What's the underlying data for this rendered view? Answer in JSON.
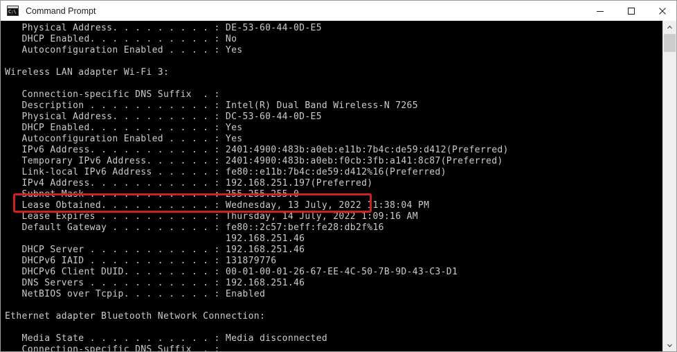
{
  "window": {
    "title": "Command Prompt",
    "icon": "command-prompt-icon",
    "icon_glyph": "C:\\",
    "controls": {
      "minimize": "Minimize",
      "maximize": "Maximize",
      "close": "Close"
    }
  },
  "colors": {
    "titlebar_bg": "#ffffff",
    "console_bg": "#000000",
    "console_text": "#cccccc",
    "highlight_red": "#cc2222",
    "scrollbar_track": "#efefef",
    "scrollbar_thumb": "#cdcdcd"
  },
  "console": {
    "lines": [
      "   Physical Address. . . . . . . . . : DE-53-60-44-0D-E5",
      "   DHCP Enabled. . . . . . . . . . . : No",
      "   Autoconfiguration Enabled . . . . : Yes",
      "",
      "Wireless LAN adapter Wi-Fi 3:",
      "",
      "   Connection-specific DNS Suffix  . :",
      "   Description . . . . . . . . . . . : Intel(R) Dual Band Wireless-N 7265",
      "   Physical Address. . . . . . . . . : DC-53-60-44-0D-E5",
      "   DHCP Enabled. . . . . . . . . . . : Yes",
      "   Autoconfiguration Enabled . . . . : Yes",
      "   IPv6 Address. . . . . . . . . . . : 2401:4900:483b:a0eb:e11b:7b4c:de59:d412(Preferred)",
      "   Temporary IPv6 Address. . . . . . : 2401:4900:483b:a0eb:f0cb:3fb:a141:8c87(Preferred)",
      "   Link-local IPv6 Address . . . . . : fe80::e11b:7b4c:de59:d412%16(Preferred)",
      "   IPv4 Address. . . . . . . . . . . : 192.168.251.197(Preferred)",
      "   Subnet Mask . . . . . . . . . . . : 255.255.255.0",
      "   Lease Obtained. . . . . . . . . . : Wednesday, 13 July, 2022 11:38:04 PM",
      "   Lease Expires . . . . . . . . . . : Thursday, 14 July, 2022 1:09:16 AM",
      "   Default Gateway . . . . . . . . . : fe80::2c57:beff:fe28:db2f%16",
      "                                       192.168.251.46",
      "   DHCP Server . . . . . . . . . . . : 192.168.251.46",
      "   DHCPv6 IAID . . . . . . . . . . . : 131879776",
      "   DHCPv6 Client DUID. . . . . . . . : 00-01-00-01-26-67-EE-4C-50-7B-9D-43-C3-D1",
      "   DNS Servers . . . . . . . . . . . : 192.168.251.46",
      "   NetBIOS over Tcpip. . . . . . . . : Enabled",
      "",
      "Ethernet adapter Bluetooth Network Connection:",
      "",
      "   Media State . . . . . . . . . . . : Media disconnected",
      "   Connection-specific DNS Suffix  . :"
    ],
    "highlighted_line_index": 14,
    "highlighted_text": "IPv4 Address. . . . . . . . . . . : 192.168.251.197(Preferred)"
  },
  "scrollbar": {
    "up_arrow": "chevron-up-icon",
    "down_arrow": "chevron-down-icon"
  }
}
